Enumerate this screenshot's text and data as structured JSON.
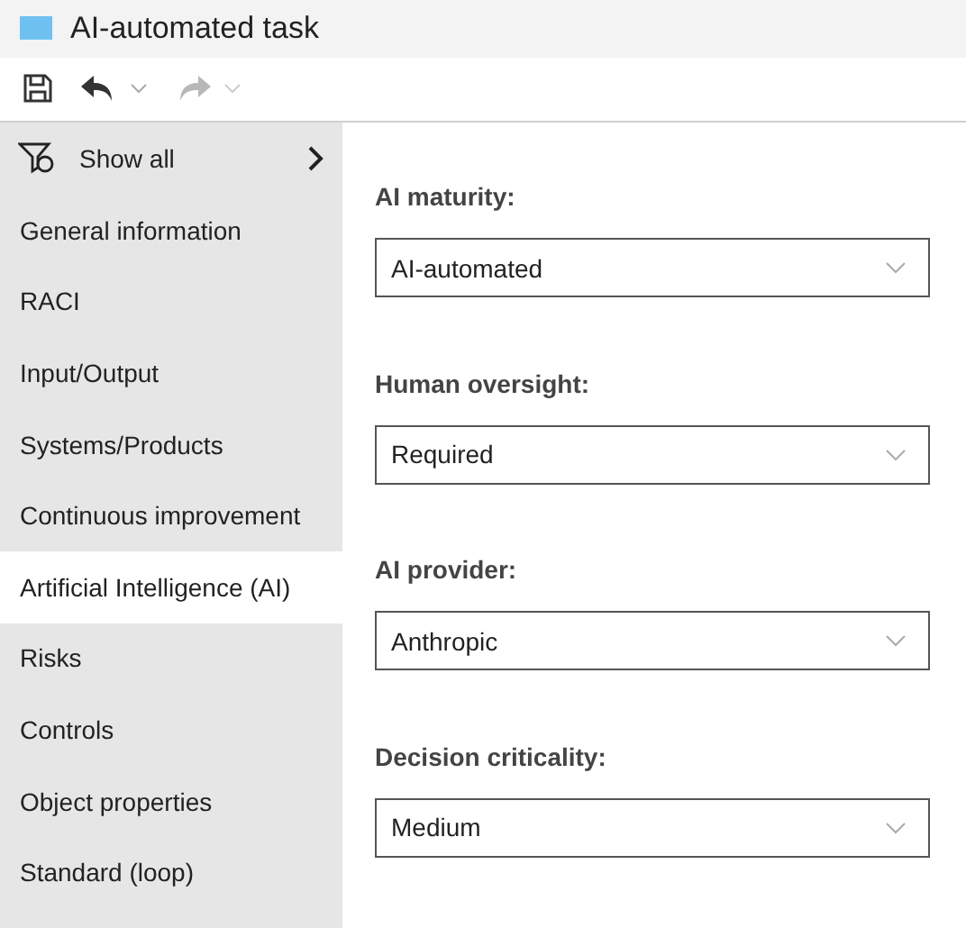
{
  "window": {
    "title": "AI-automated task"
  },
  "toolbar": {
    "undo": {
      "disabled": false
    },
    "redo": {
      "disabled": true
    }
  },
  "sidebar": {
    "show_all": "Show all",
    "items": [
      {
        "label": "General information",
        "selected": false
      },
      {
        "label": "RACI",
        "selected": false
      },
      {
        "label": "Input/Output",
        "selected": false
      },
      {
        "label": "Systems/Products",
        "selected": false
      },
      {
        "label": "Continuous improvement",
        "selected": false
      },
      {
        "label": "Artificial Intelligence (AI)",
        "selected": true
      },
      {
        "label": "Risks",
        "selected": false
      },
      {
        "label": "Controls",
        "selected": false
      },
      {
        "label": "Object properties",
        "selected": false
      },
      {
        "label": "Standard (loop)",
        "selected": false
      }
    ]
  },
  "fields": [
    {
      "label": "AI maturity:",
      "value": "AI-automated"
    },
    {
      "label": "Human oversight:",
      "value": "Required"
    },
    {
      "label": "AI provider:",
      "value": "Anthropic"
    },
    {
      "label": "Decision criticality:",
      "value": "Medium"
    }
  ]
}
